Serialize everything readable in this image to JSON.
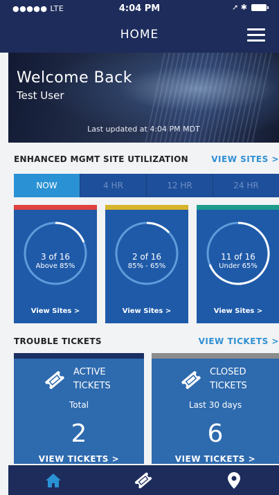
{
  "status_bar": {
    "carrier": "●●●●● LTE",
    "time": "4:04 PM",
    "indicators": "➚ ✱"
  },
  "nav": {
    "title": "HOME"
  },
  "hero": {
    "welcome": "Welcome Back",
    "user": "Test User",
    "last_updated": "Last updated at 4:04 PM MDT"
  },
  "utilization": {
    "title": "ENHANCED MGMT SITE UTILIZATION",
    "link": "VIEW SITES >",
    "tabs": [
      "NOW",
      "4 HR",
      "12 HR",
      "24 HR"
    ],
    "active_tab": "NOW",
    "cards": [
      {
        "count": "3 of 16",
        "range": "Above 85%",
        "link": "View Sites >",
        "color": "#e0403f",
        "fraction": 0.19
      },
      {
        "count": "2 of 16",
        "range": "85% - 65%",
        "link": "View Sites >",
        "color": "#d6b52c",
        "fraction": 0.13
      },
      {
        "count": "11 of 16",
        "range": "Under 65%",
        "link": "View Sites >",
        "color": "#1c9c8b",
        "fraction": 0.69
      }
    ]
  },
  "tickets": {
    "title": "TROUBLE TICKETS",
    "link": "VIEW TICKETS >",
    "active": {
      "line1": "ACTIVE",
      "line2": "TICKETS",
      "sub": "Total",
      "count": "2",
      "link": "VIEW TICKETS >",
      "color": "#1c2f63"
    },
    "closed": {
      "line1": "CLOSED",
      "line2": "TICKETS",
      "sub": "Last 30 days",
      "count": "6",
      "link": "VIEW TICKETS >",
      "color": "#8c8c8c"
    }
  },
  "bottom_nav": {
    "icons": [
      "home-icon",
      "ticket-icon",
      "location-pin-icon"
    ],
    "active": "home-icon",
    "active_color": "#2a92d4"
  }
}
